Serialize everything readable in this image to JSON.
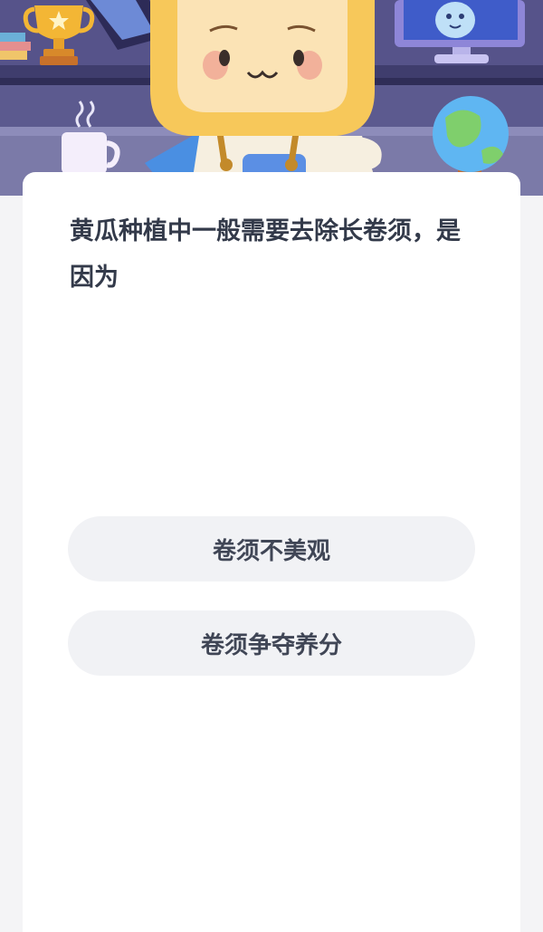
{
  "quiz": {
    "question": "黄瓜种植中一般需要去除长卷须，是因为",
    "options": [
      {
        "label": "卷须不美观"
      },
      {
        "label": "卷须争夺养分"
      }
    ]
  },
  "illustration": {
    "icons": [
      "trophy-icon",
      "books-icon",
      "coffee-cup-icon",
      "monitor-icon",
      "globe-icon",
      "mascot-character"
    ]
  },
  "colors": {
    "header_bg": "#5f5c92",
    "card_bg": "#ffffff",
    "option_bg": "#f1f2f5",
    "question_text": "#333a4a",
    "mascot_hood": "#f7c85a"
  }
}
